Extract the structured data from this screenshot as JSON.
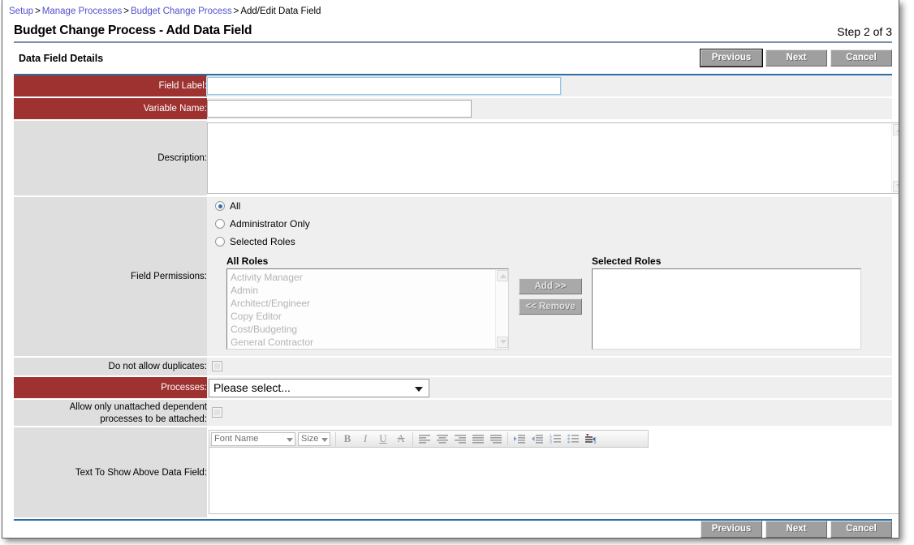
{
  "breadcrumb": {
    "items": [
      {
        "label": "Setup",
        "link": true
      },
      {
        "label": "Manage Processes",
        "link": true
      },
      {
        "label": "Budget Change Process",
        "link": true
      },
      {
        "label": "Add/Edit Data Field",
        "link": false
      }
    ],
    "separator": ">"
  },
  "header": {
    "title": "Budget Change Process - Add Data Field",
    "step_indicator": "Step 2 of 3"
  },
  "section": {
    "title": "Data Field Details"
  },
  "toolbar_buttons": {
    "previous": "Previous",
    "next": "Next",
    "cancel": "Cancel"
  },
  "form": {
    "field_label": {
      "label": "Field Label:",
      "value": "",
      "required": true
    },
    "variable_name": {
      "label": "Variable Name:",
      "value": "",
      "required": true
    },
    "description": {
      "label": "Description:",
      "value": "",
      "required": false
    },
    "field_permissions": {
      "label": "Field Permissions:",
      "options": [
        {
          "label": "All",
          "selected": true
        },
        {
          "label": "Administrator Only",
          "selected": false
        },
        {
          "label": "Selected Roles",
          "selected": false
        }
      ],
      "all_roles": {
        "title": "All Roles",
        "items": [
          "Activity Manager",
          "Admin",
          "Architect/Engineer",
          "Copy Editor",
          "Cost/Budgeting",
          "General Contractor"
        ]
      },
      "selected_roles": {
        "title": "Selected Roles",
        "items": []
      },
      "add_button": "Add >>",
      "remove_button": "<< Remove"
    },
    "no_duplicates": {
      "label": "Do not allow duplicates:",
      "checked": false
    },
    "processes": {
      "label": "Processes:",
      "selected": "Please select...",
      "required": true
    },
    "unattached_dependent": {
      "label_line1": "Allow only unattached dependent",
      "label_line2": "processes to be attached:",
      "checked": false
    },
    "text_above": {
      "label": "Text To Show Above Data Field:",
      "value": ""
    }
  },
  "editor": {
    "font_name": "Font Name",
    "font_size": "Size",
    "buttons": [
      {
        "icon": "bold-icon",
        "glyph": "B"
      },
      {
        "icon": "italic-icon",
        "glyph": "I"
      },
      {
        "icon": "underline-icon",
        "glyph": "U"
      },
      {
        "icon": "strikethrough-icon",
        "glyph": "A"
      },
      {
        "icon": "align-left-icon",
        "glyph": ""
      },
      {
        "icon": "align-center-icon",
        "glyph": ""
      },
      {
        "icon": "align-right-icon",
        "glyph": ""
      },
      {
        "icon": "align-justify-icon",
        "glyph": ""
      },
      {
        "icon": "align-distribute-icon",
        "glyph": ""
      },
      {
        "icon": "indent-increase-icon",
        "glyph": ""
      },
      {
        "icon": "indent-decrease-icon",
        "glyph": ""
      },
      {
        "icon": "numbered-list-icon",
        "glyph": ""
      },
      {
        "icon": "bulleted-list-icon",
        "glyph": ""
      },
      {
        "icon": "paragraph-direction-icon",
        "glyph": ""
      }
    ]
  },
  "colors": {
    "required_label_bg": "#9e3231",
    "label_bg": "#dedede",
    "field_bg": "#efefef",
    "accent_border": "#2e6da4",
    "link": "#5050d0",
    "button_bg": "#9f9f9f"
  }
}
